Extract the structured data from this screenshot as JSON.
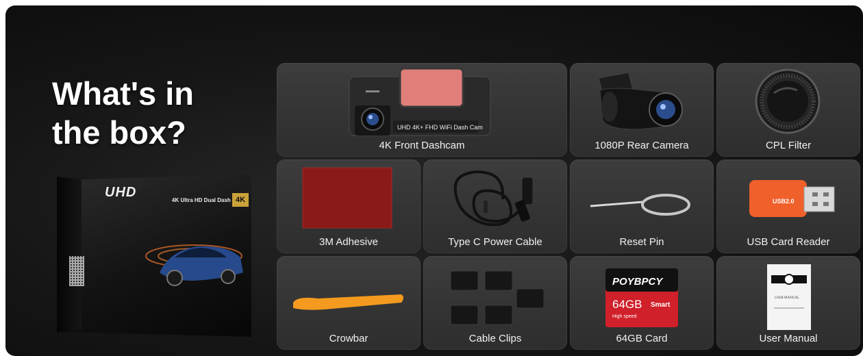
{
  "headline": {
    "line1": "What's in",
    "line2": "the box?"
  },
  "product_box": {
    "brand": "UHD",
    "subtitle": "4K Ultra HD Dual Dash Cam",
    "badge": "4K"
  },
  "items": [
    {
      "label": "4K Front Dashcam",
      "device_text": "UHD 4K+ FHD WiFi Dash Cam"
    },
    {
      "label": "1080P Rear Camera"
    },
    {
      "label": "CPL Filter"
    },
    {
      "label": "3M Adhesive"
    },
    {
      "label": "Type C Power Cable"
    },
    {
      "label": "Reset Pin"
    },
    {
      "label": "USB Card Reader",
      "device_text": "USB2.0"
    },
    {
      "label": "Crowbar"
    },
    {
      "label": "Cable Clips"
    },
    {
      "label": "64GB Card",
      "card_brand": "POYBPCY",
      "card_capacity": "64GB",
      "card_type": "Smart",
      "card_sub": "High speed"
    },
    {
      "label": "User Manual",
      "manual_title": "USER MANUAL"
    }
  ],
  "colors": {
    "background": "#151515",
    "card": "#383838",
    "adhesive": "#8a1a1a",
    "crowbar": "#f39a1f",
    "reader": "#f0602a",
    "sd_card": "#d0202a"
  }
}
